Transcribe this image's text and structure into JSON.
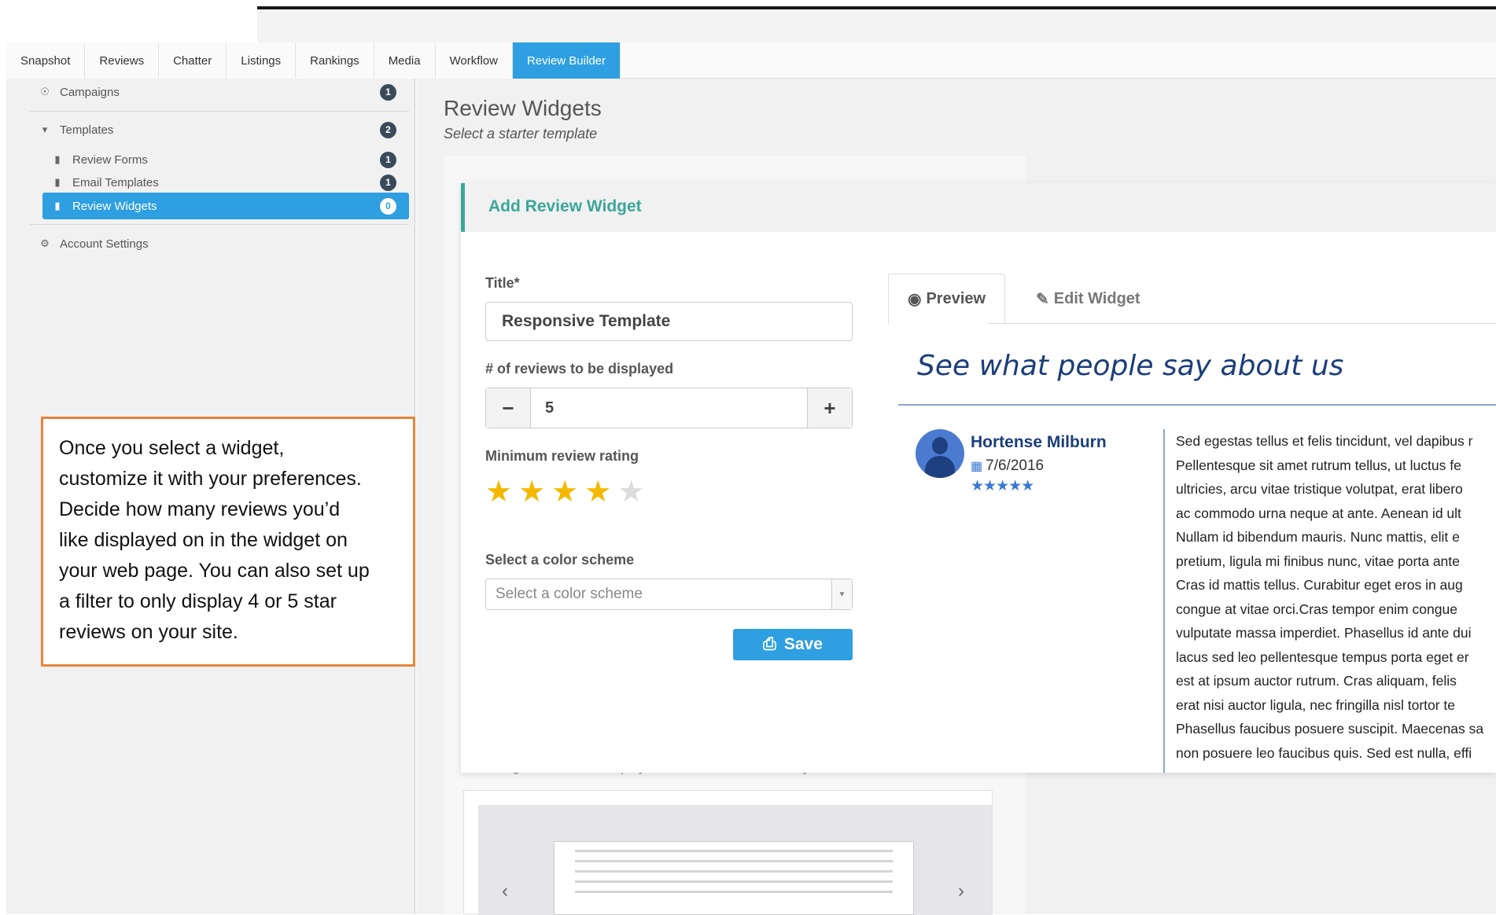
{
  "tabs": [
    {
      "label": "Snapshot"
    },
    {
      "label": "Reviews"
    },
    {
      "label": "Chatter"
    },
    {
      "label": "Listings"
    },
    {
      "label": "Rankings"
    },
    {
      "label": "Media"
    },
    {
      "label": "Workflow"
    },
    {
      "label": "Review Builder",
      "active": true
    }
  ],
  "sidebar": {
    "campaigns": {
      "label": "Campaigns",
      "count": "1",
      "icon": "bullhorn-icon"
    },
    "templates": {
      "label": "Templates",
      "count": "2",
      "icon": "caret-down-icon"
    },
    "review_forms": {
      "label": "Review Forms",
      "count": "1",
      "icon": "file-icon"
    },
    "email_templates": {
      "label": "Email Templates",
      "count": "1",
      "icon": "file-icon"
    },
    "review_widgets": {
      "label": "Review Widgets",
      "count": "0",
      "icon": "file-icon"
    },
    "account_settings": {
      "label": "Account Settings",
      "icon": "gear-icon"
    }
  },
  "callout": {
    "lines": [
      "Once you select a widget,",
      "customize it with your preferences.",
      "Decide how many reviews you’d",
      "like displayed on in the widget on",
      "your web page.  You can also set up",
      "a filter to only display 4 or 5 star",
      "reviews on your site."
    ]
  },
  "main": {
    "title": "Review Widgets",
    "subtitle": "Select a starter template",
    "carousel_caption": "A rotating carousel that displays reviews in a flash-card style format."
  },
  "panel": {
    "header": "Add Review Widget",
    "title_label": "Title*",
    "title_value": "Responsive Template",
    "reviews_label": "# of reviews to be displayed",
    "reviews_value": "5",
    "minus": "−",
    "plus": "+",
    "min_rating_label": "Minimum review rating",
    "min_rating": 4,
    "min_rating_max": 5,
    "color_label": "Select a color scheme",
    "color_placeholder": "Select a color scheme",
    "save_label": "Save",
    "accent_color": "#3aa79a",
    "primary_color": "#2e9fe0",
    "star_color": "#f5b800"
  },
  "preview": {
    "tab_preview": "Preview",
    "tab_edit": "Edit Widget",
    "heading": "See what people say about us",
    "reviewer": "Hortense Milburn",
    "date": "7/6/2016",
    "stars": "★★★★★",
    "text_lines": [
      "Sed egestas tellus et felis tincidunt, vel dapibus r",
      "Pellentesque sit amet rutrum tellus, ut luctus fe",
      "ultricies, arcu vitae tristique volutpat, erat libero",
      "ac commodo urna neque at ante. Aenean id ult",
      "Nullam id bibendum mauris. Nunc mattis, elit e",
      "pretium, ligula mi finibus nunc, vitae porta ante",
      "Cras id mattis tellus. Curabitur eget eros in aug",
      "congue at vitae orci.Cras tempor enim congue",
      "vulputate massa imperdiet. Phasellus id ante dui",
      "lacus sed leo pellentesque tempus porta eget er",
      "est at ipsum auctor rutrum. Cras aliquam, felis",
      "erat nisi auctor ligula, nec fringilla nisl tortor te",
      "Phasellus faucibus posuere suscipit. Maecenas sa",
      "non posuere leo faucibus quis. Sed est nulla, effi"
    ]
  }
}
